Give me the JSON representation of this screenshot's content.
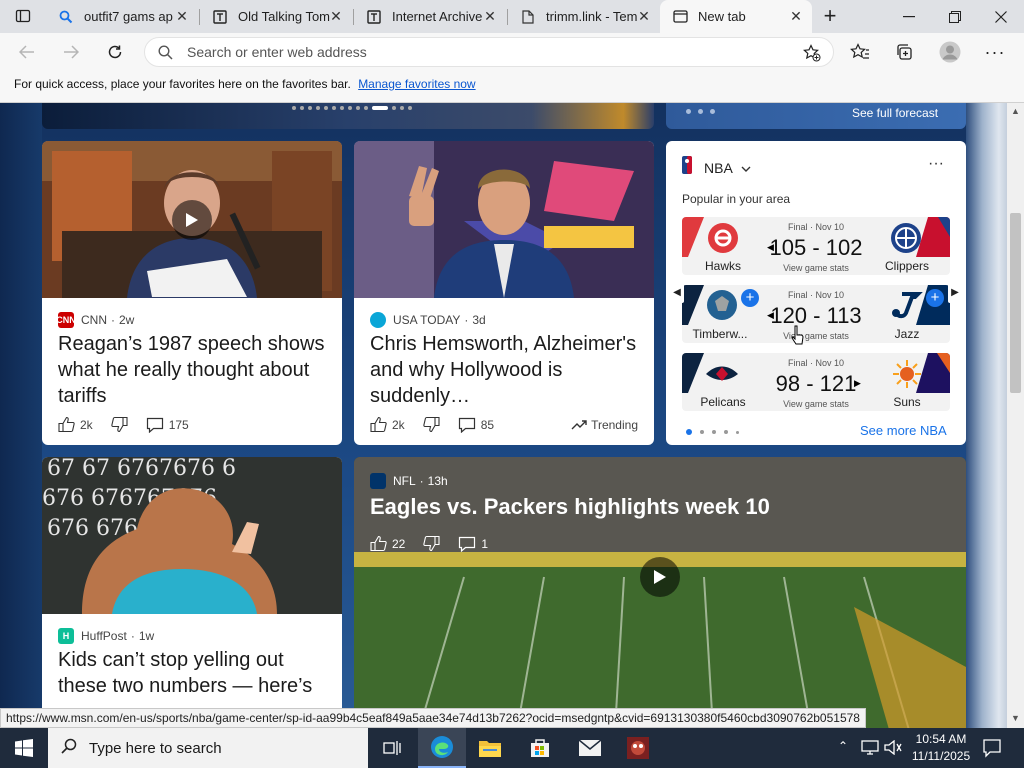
{
  "tabs": [
    {
      "label": "outfit7 gams ap",
      "icon": "search-icon"
    },
    {
      "label": "Old Talking Tom",
      "icon": "page-icon"
    },
    {
      "label": "Internet Archive",
      "icon": "archive-icon"
    },
    {
      "label": "trimm.link - Tem",
      "icon": "document-icon"
    },
    {
      "label": "New tab",
      "icon": "new-tab-icon",
      "active": true
    }
  ],
  "address_bar": {
    "placeholder": "Search or enter web address"
  },
  "favorites_bar": {
    "text": "For quick access, place your favorites here on the favorites bar.",
    "link": "Manage favorites now"
  },
  "weather": {
    "see_full_forecast": "See full forecast"
  },
  "cards": [
    {
      "source": "CNN",
      "age": "2w",
      "headline": "Reagan’s 1987 speech shows what he really thought about tariffs",
      "likes": "2k",
      "comments": "175"
    },
    {
      "source": "USA TODAY",
      "age": "3d",
      "headline": "Chris Hemsworth, Alzheimer's and why Hollywood is suddenly…",
      "likes": "2k",
      "comments": "85",
      "trending": "Trending"
    },
    {
      "source": "HuffPost",
      "age": "1w",
      "headline": "Kids can’t stop yelling out these two numbers — here’s"
    },
    {
      "source": "NFL",
      "age": "13h",
      "headline": "Eagles vs. Packers highlights week 10",
      "likes": "22",
      "comments": "1"
    }
  ],
  "nba": {
    "title": "NBA",
    "subtitle": "Popular in your area",
    "games": [
      {
        "status": "Final · Nov 10",
        "home": "Hawks",
        "away": "Clippers",
        "score": "105 - 102",
        "link": "View game stats"
      },
      {
        "status": "Final · Nov 10",
        "home": "Timberw...",
        "away": "Jazz",
        "score": "120 - 113",
        "link": "View game stats"
      },
      {
        "status": "Final · Nov 10",
        "home": "Pelicans",
        "away": "Suns",
        "score": "98 - 121",
        "link": "View game stats"
      }
    ],
    "see_more": "See more NBA"
  },
  "status_url": "https://www.msn.com/en-us/sports/nba/game-center/sp-id-aa99b4c5eaf849a5aae34e74d13b7262?ocid=msedgntp&cvid=6913130380f5460cbd3090762b051578",
  "taskbar": {
    "search_placeholder": "Type here to search",
    "time": "10:54 AM",
    "date": "11/11/2025"
  }
}
